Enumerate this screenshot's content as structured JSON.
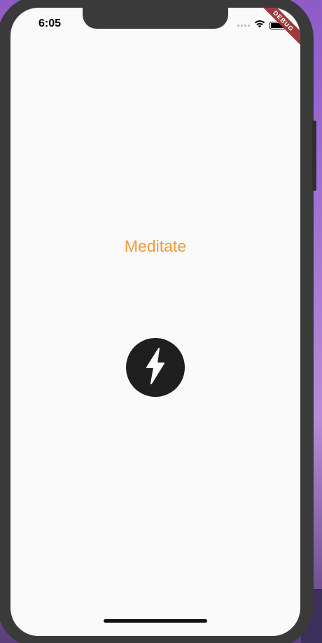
{
  "status_bar": {
    "time": "6:05",
    "wifi_icon": "wifi-icon",
    "battery_icon": "battery-icon",
    "debug_label": "DEBUG"
  },
  "main": {
    "title": "Meditate",
    "action_icon": "lightning-bolt-icon"
  },
  "colors": {
    "title": "#f19a3e",
    "button_bg": "#1f1f1f",
    "screen_bg": "#fafafa",
    "debug_banner": "#a0393b"
  }
}
